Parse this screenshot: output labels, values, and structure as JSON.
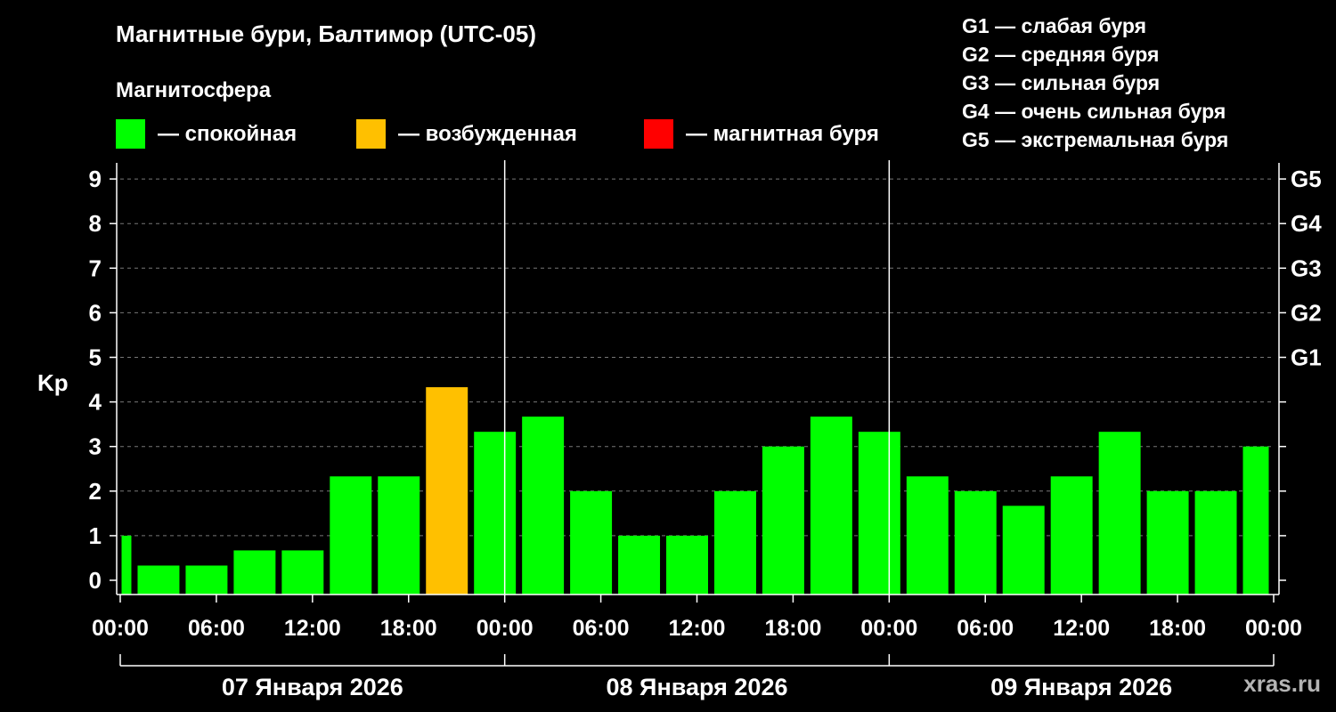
{
  "chart_data": {
    "type": "bar",
    "title": "Магнитные бури, Балтимор (UTC-05)",
    "ylabel": "Kp",
    "ylim": [
      0,
      9
    ],
    "y_ticks": [
      "0",
      "1",
      "2",
      "3",
      "4",
      "5",
      "6",
      "7",
      "8",
      "9"
    ],
    "storm_levels": [
      {
        "label": "G1",
        "kp": 5
      },
      {
        "label": "G2",
        "kp": 6
      },
      {
        "label": "G3",
        "kp": 7
      },
      {
        "label": "G4",
        "kp": 8
      },
      {
        "label": "G5",
        "kp": 9
      }
    ],
    "x_ticks": [
      "00:00",
      "06:00",
      "12:00",
      "18:00",
      "00:00",
      "06:00",
      "12:00",
      "18:00",
      "00:00",
      "06:00",
      "12:00",
      "18:00",
      "00:00"
    ],
    "days": [
      "07 Января 2026",
      "08 Января 2026",
      "09 Января 2026"
    ],
    "bars": [
      {
        "start_hour": 0,
        "end_hour": 1,
        "kp": 1.0,
        "level": "calm"
      },
      {
        "start_hour": 1,
        "end_hour": 4,
        "kp": 0.33,
        "level": "calm"
      },
      {
        "start_hour": 4,
        "end_hour": 7,
        "kp": 0.33,
        "level": "calm"
      },
      {
        "start_hour": 7,
        "end_hour": 10,
        "kp": 0.67,
        "level": "calm"
      },
      {
        "start_hour": 10,
        "end_hour": 13,
        "kp": 0.67,
        "level": "calm"
      },
      {
        "start_hour": 13,
        "end_hour": 16,
        "kp": 2.33,
        "level": "calm"
      },
      {
        "start_hour": 16,
        "end_hour": 19,
        "kp": 2.33,
        "level": "calm"
      },
      {
        "start_hour": 19,
        "end_hour": 22,
        "kp": 4.33,
        "level": "excited"
      },
      {
        "start_hour": 22,
        "end_hour": 25,
        "kp": 3.33,
        "level": "calm"
      },
      {
        "start_hour": 25,
        "end_hour": 28,
        "kp": 3.67,
        "level": "calm"
      },
      {
        "start_hour": 28,
        "end_hour": 31,
        "kp": 2.0,
        "level": "calm"
      },
      {
        "start_hour": 31,
        "end_hour": 34,
        "kp": 1.0,
        "level": "calm"
      },
      {
        "start_hour": 34,
        "end_hour": 37,
        "kp": 1.0,
        "level": "calm"
      },
      {
        "start_hour": 37,
        "end_hour": 40,
        "kp": 2.0,
        "level": "calm"
      },
      {
        "start_hour": 40,
        "end_hour": 43,
        "kp": 3.0,
        "level": "calm"
      },
      {
        "start_hour": 43,
        "end_hour": 46,
        "kp": 3.67,
        "level": "calm"
      },
      {
        "start_hour": 46,
        "end_hour": 49,
        "kp": 3.33,
        "level": "calm"
      },
      {
        "start_hour": 49,
        "end_hour": 52,
        "kp": 2.33,
        "level": "calm"
      },
      {
        "start_hour": 52,
        "end_hour": 55,
        "kp": 2.0,
        "level": "calm"
      },
      {
        "start_hour": 55,
        "end_hour": 58,
        "kp": 1.67,
        "level": "calm"
      },
      {
        "start_hour": 58,
        "end_hour": 61,
        "kp": 2.33,
        "level": "calm"
      },
      {
        "start_hour": 61,
        "end_hour": 64,
        "kp": 3.33,
        "level": "calm"
      },
      {
        "start_hour": 64,
        "end_hour": 67,
        "kp": 2.0,
        "level": "calm"
      },
      {
        "start_hour": 67,
        "end_hour": 70,
        "kp": 2.0,
        "level": "calm"
      },
      {
        "start_hour": 70,
        "end_hour": 72,
        "kp": 3.0,
        "level": "calm"
      }
    ],
    "x_range_hours": [
      0,
      72
    ],
    "grid": "dashed horizontal",
    "legend": {
      "heading": "Магнитосфера",
      "items": [
        {
          "key": "calm",
          "label": "— спокойная",
          "color": "#00ff00"
        },
        {
          "key": "excited",
          "label": "— возбужденная",
          "color": "#ffc000"
        },
        {
          "key": "storm",
          "label": "— магнитная буря",
          "color": "#ff0000"
        }
      ],
      "placement": "top-left"
    },
    "storm_scale": [
      "G1 — слабая буря",
      "G2 — средняя буря",
      "G3 — сильная буря",
      "G4 — очень сильная буря",
      "G5 — экстремальная буря"
    ],
    "watermark": "xras.ru",
    "colors": {
      "background": "#000000",
      "text": "#ffffff",
      "grid": "#777777",
      "axis": "#ffffff",
      "watermark": "#b4b4b4"
    }
  }
}
